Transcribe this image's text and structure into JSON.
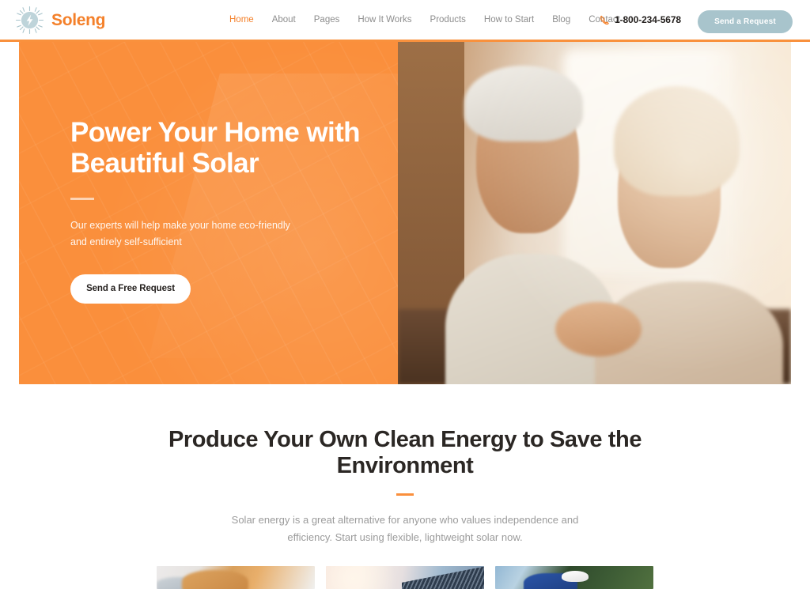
{
  "header": {
    "logo": {
      "text": "Soleng",
      "icon": "sun-bolt-icon"
    },
    "nav": [
      {
        "label": "Home",
        "active": true
      },
      {
        "label": "About",
        "active": false
      },
      {
        "label": "Pages",
        "active": false
      },
      {
        "label": "How It Works",
        "active": false
      },
      {
        "label": "Products",
        "active": false
      },
      {
        "label": "How to Start",
        "active": false
      },
      {
        "label": "Blog",
        "active": false
      },
      {
        "label": "Contact",
        "active": false
      }
    ],
    "phone": {
      "icon": "phone-icon",
      "number": "1-800-234-5678"
    },
    "cta": {
      "label": "Send a Request",
      "color": "#a8c4cc"
    }
  },
  "hero": {
    "title": "Power Your Home with Beautiful Solar",
    "subtitle": "Our experts will help make your home eco-friendly and entirely self-sufficient",
    "button": "Send a Free Request",
    "background_color": "#fa8f3c",
    "image_alt": "Smiling elderly couple embracing indoors"
  },
  "section": {
    "title": "Produce Your Own Clean Energy to Save the Environment",
    "accent_color": "#fa8f3c",
    "text": "Solar energy is a great alternative for anyone who values independence and efficiency. Start using flexible, lightweight solar now.",
    "cards": [
      {
        "alt": "Worker in hard hat leaning over"
      },
      {
        "alt": "Solar panel array in bright sunlight"
      },
      {
        "alt": "Technician in white helmet among pine trees"
      }
    ]
  }
}
